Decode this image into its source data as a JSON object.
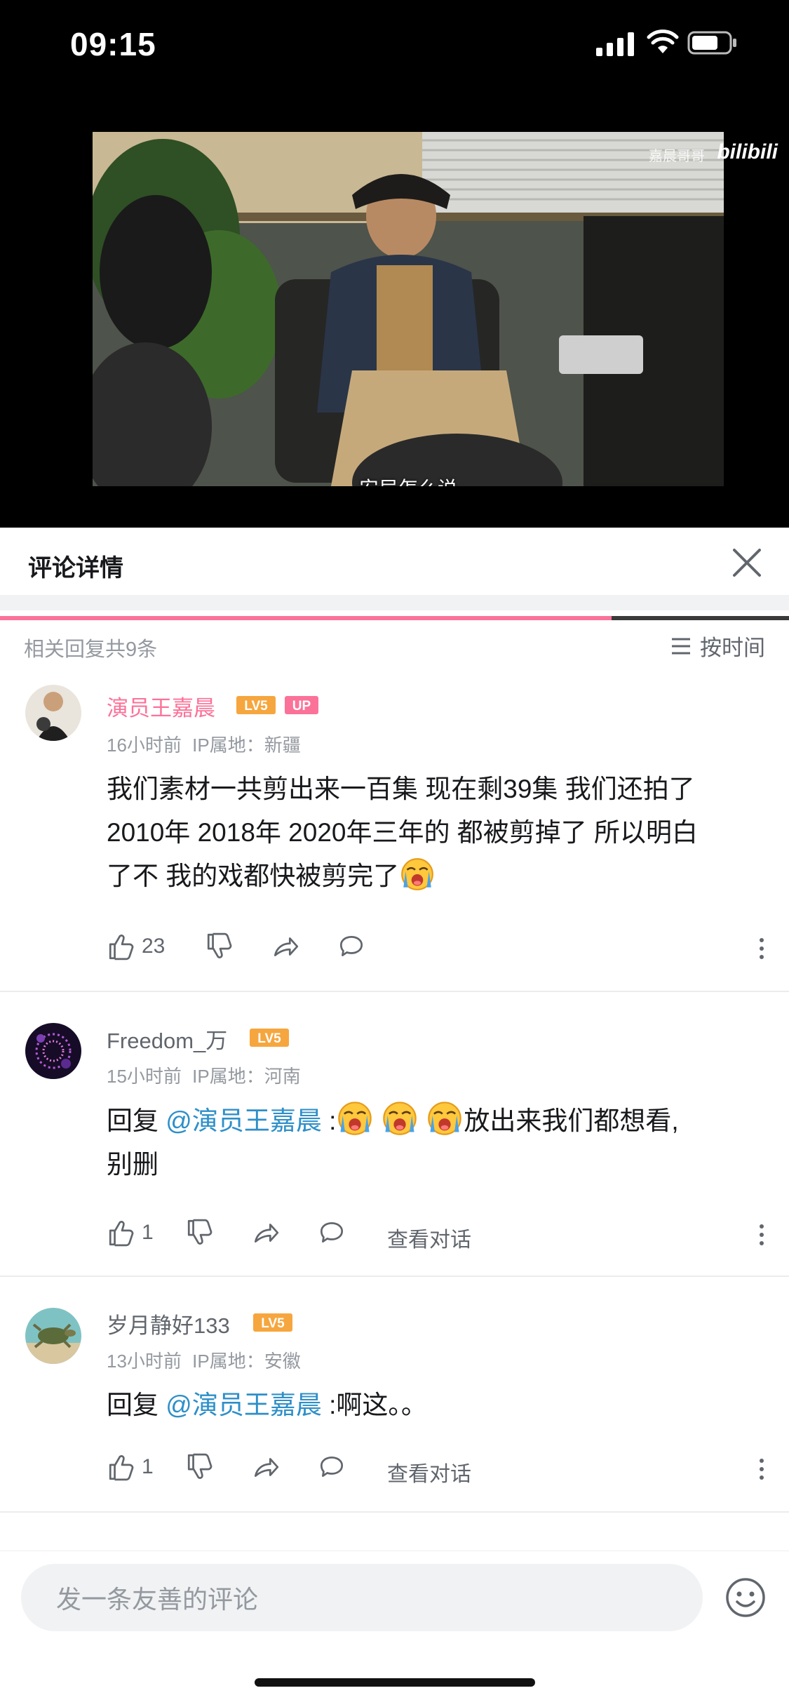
{
  "status_bar": {
    "time": "09:15"
  },
  "video": {
    "subtitle": "安局怎么说",
    "watermark": "嘉晨哥哥",
    "logo_text": "bilibili",
    "progress_fraction": 0.775,
    "progress_color": "#fb7299"
  },
  "panel": {
    "title": "评论详情",
    "reply_count": "相关回复共9条",
    "sort_label": "按时间"
  },
  "comments": [
    {
      "username": "演员王嘉晨",
      "username_color": "#fb7299",
      "level": "LV5",
      "badge": "UP",
      "time": "16小时前",
      "ip": "IP属地：新疆",
      "line1": "我们素材一共剪出来一百集 现在剩39集 我们还拍了",
      "line2": "2010年 2018年 2020年三年的 都被剪掉了 所以明白",
      "line3": "了不 我的戏都快被剪完了",
      "likes": "23"
    },
    {
      "username": "Freedom_万",
      "username_color": "#61666d",
      "level": "LV5",
      "time": "15小时前",
      "ip": "IP属地：河南",
      "reply_prefix": "回复 ",
      "mention": "@演员王嘉晨",
      "colon": " :",
      "text_after": "放出来我们都想看,",
      "line2": "别删",
      "likes": "1",
      "view_conversation": "查看对话"
    },
    {
      "username": "岁月静好133",
      "username_color": "#61666d",
      "level": "LV5",
      "time": "13小时前",
      "ip": "IP属地：安徽",
      "reply_prefix": "回复 ",
      "mention": "@演员王嘉晨",
      "colon": " :",
      "text_after": "啊这。。",
      "likes": "1",
      "view_conversation": "查看对话"
    }
  ],
  "bottom_bar": {
    "input_placeholder": "发一条友善的评论"
  },
  "icons": {
    "close": "close-icon",
    "sort": "list-icon",
    "like": "thumbs-up-icon",
    "dislike": "thumbs-down-icon",
    "share": "share-icon",
    "reply": "comment-icon",
    "more": "more-vertical-icon",
    "emoji": "emoji-icon",
    "crying": "crying-emoji-icon"
  },
  "colors": {
    "accent_pink": "#fb7299",
    "link_blue": "#2e8fc9",
    "level_orange": "#f6a63e",
    "secondary_text": "#9499a0"
  }
}
